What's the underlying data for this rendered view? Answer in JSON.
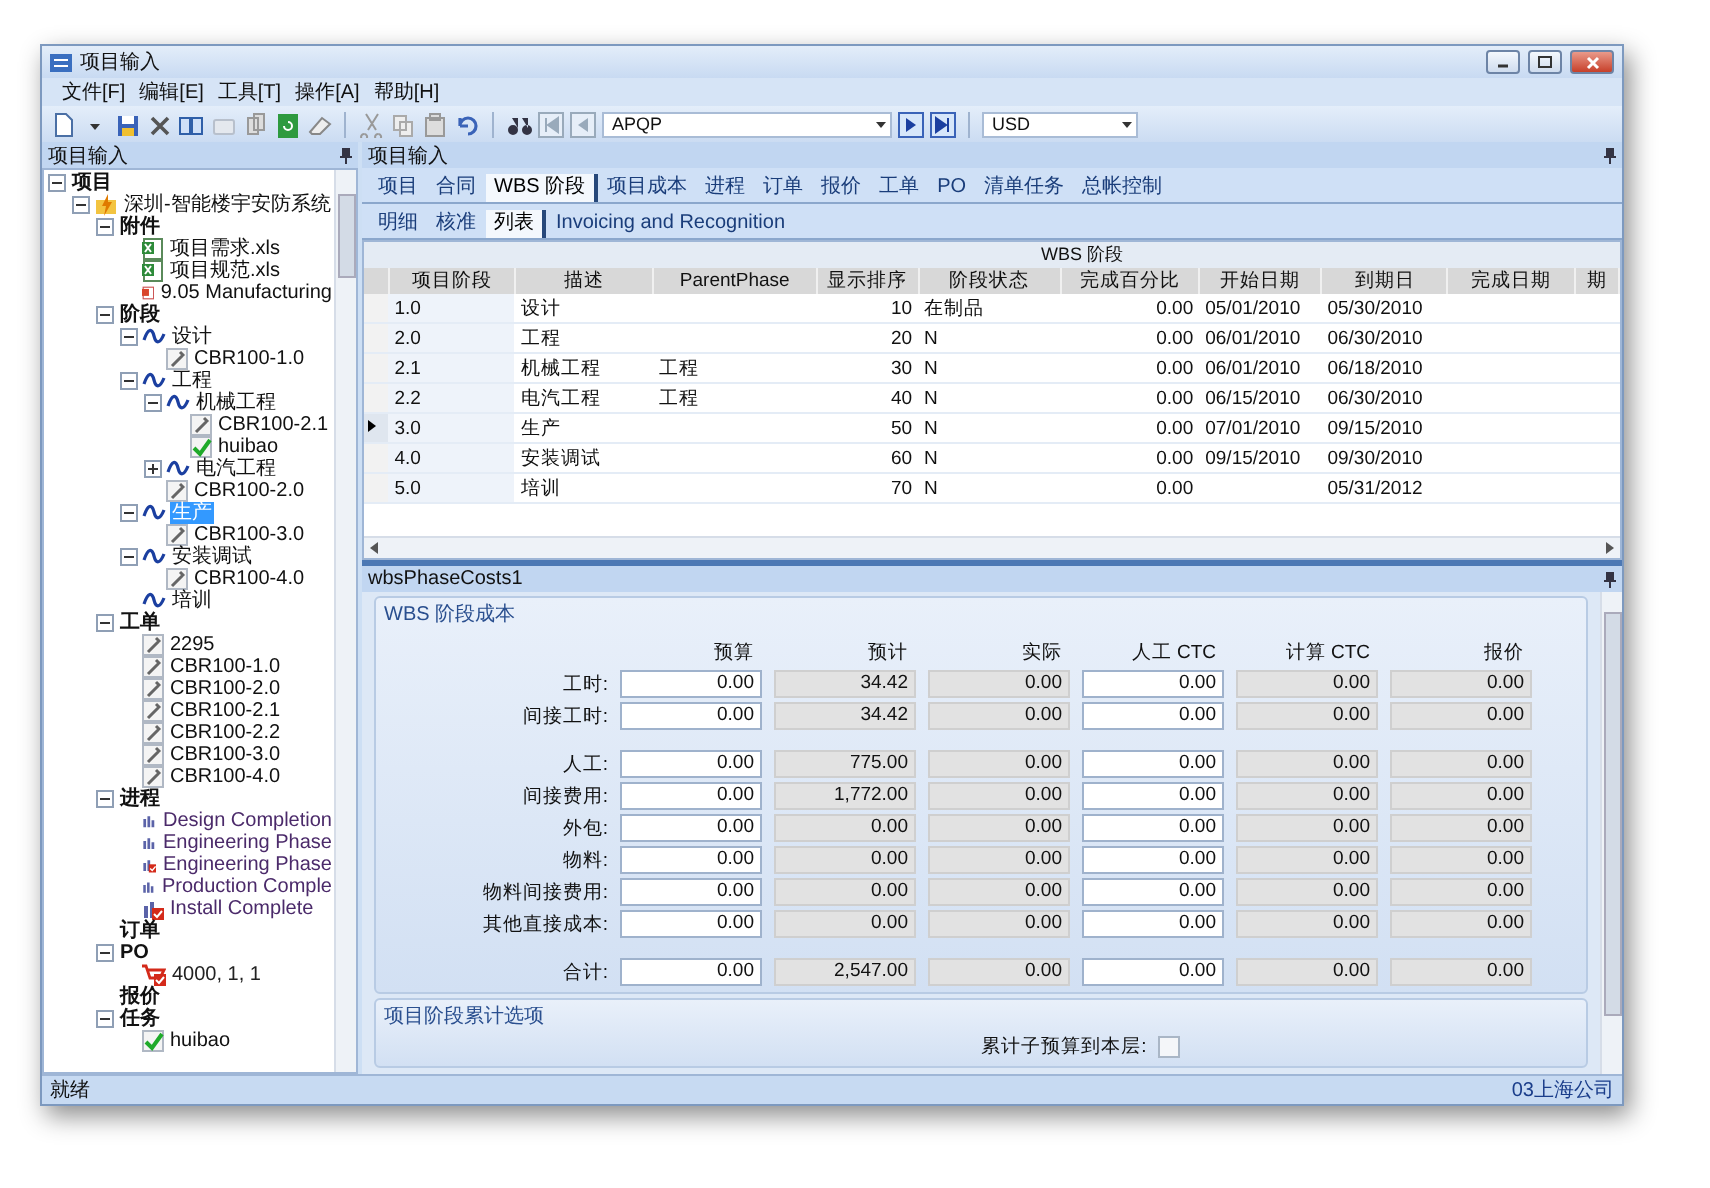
{
  "window": {
    "title": "项目输入"
  },
  "menu": [
    "文件[F]",
    "编辑[E]",
    "工具[T]",
    "操作[A]",
    "帮助[H]"
  ],
  "toolbar": {
    "record_combo": {
      "value": "APQP"
    },
    "currency_combo": {
      "value": "USD"
    }
  },
  "left_panel": {
    "title": "项目输入",
    "tree": [
      {
        "label": "项目",
        "kind": "category",
        "expanded": true,
        "selected": false,
        "children": [
          {
            "label": "深圳-智能楼宇安防系统",
            "kind": "project",
            "expanded": true,
            "selected": false,
            "children": [
              {
                "label": "附件",
                "kind": "category",
                "expanded": true,
                "selected": false,
                "children": [
                  {
                    "label": "项目需求.xls",
                    "kind": "excel",
                    "selected": false
                  },
                  {
                    "label": "项目规范.xls",
                    "kind": "excel",
                    "selected": false
                  },
                  {
                    "label": "9.05 Manufacturing",
                    "kind": "document",
                    "selected": false
                  }
                ]
              },
              {
                "label": "阶段",
                "kind": "category",
                "expanded": true,
                "selected": false,
                "children": [
                  {
                    "label": "设计",
                    "kind": "phase",
                    "expanded": true,
                    "selected": false,
                    "children": [
                      {
                        "label": "CBR100-1.0",
                        "kind": "work-order",
                        "selected": false
                      }
                    ]
                  },
                  {
                    "label": "工程",
                    "kind": "phase",
                    "expanded": true,
                    "selected": false,
                    "children": [
                      {
                        "label": "机械工程",
                        "kind": "phase",
                        "expanded": true,
                        "selected": false,
                        "children": [
                          {
                            "label": "CBR100-2.1",
                            "kind": "work-order",
                            "selected": false
                          },
                          {
                            "label": "huibao",
                            "kind": "task",
                            "selected": false
                          }
                        ]
                      },
                      {
                        "label": "电汽工程",
                        "kind": "phase",
                        "expanded": false,
                        "selected": false
                      },
                      {
                        "label": "CBR100-2.0",
                        "kind": "work-order",
                        "selected": false
                      }
                    ]
                  },
                  {
                    "label": "生产",
                    "kind": "phase",
                    "expanded": true,
                    "selected": true,
                    "children": [
                      {
                        "label": "CBR100-3.0",
                        "kind": "work-order",
                        "selected": false
                      }
                    ]
                  },
                  {
                    "label": "安装调试",
                    "kind": "phase",
                    "expanded": true,
                    "selected": false,
                    "children": [
                      {
                        "label": "CBR100-4.0",
                        "kind": "work-order",
                        "selected": false
                      }
                    ]
                  },
                  {
                    "label": "培训",
                    "kind": "phase",
                    "selected": false
                  }
                ]
              },
              {
                "label": "工单",
                "kind": "category",
                "expanded": true,
                "selected": false,
                "children": [
                  {
                    "label": "2295",
                    "kind": "work-order",
                    "selected": false
                  },
                  {
                    "label": "CBR100-1.0",
                    "kind": "work-order",
                    "selected": false
                  },
                  {
                    "label": "CBR100-2.0",
                    "kind": "work-order",
                    "selected": false
                  },
                  {
                    "label": "CBR100-2.1",
                    "kind": "work-order",
                    "selected": false
                  },
                  {
                    "label": "CBR100-2.2",
                    "kind": "work-order",
                    "selected": false
                  },
                  {
                    "label": "CBR100-3.0",
                    "kind": "work-order",
                    "selected": false
                  },
                  {
                    "label": "CBR100-4.0",
                    "kind": "work-order",
                    "selected": false
                  }
                ]
              },
              {
                "label": "进程",
                "kind": "category",
                "expanded": true,
                "selected": false,
                "children": [
                  {
                    "label": "Design Completion",
                    "kind": "milestone",
                    "selected": false
                  },
                  {
                    "label": "Engineering Phase",
                    "kind": "milestone",
                    "selected": false
                  },
                  {
                    "label": "Engineering Phase",
                    "kind": "milestone-done",
                    "selected": false
                  },
                  {
                    "label": "Production Comple",
                    "kind": "milestone",
                    "selected": false
                  },
                  {
                    "label": "Install Complete",
                    "kind": "milestone-done",
                    "selected": false
                  }
                ]
              },
              {
                "label": "订单",
                "kind": "category",
                "selected": false
              },
              {
                "label": "PO",
                "kind": "category",
                "expanded": true,
                "selected": false,
                "children": [
                  {
                    "label": "4000, 1, 1",
                    "kind": "po",
                    "selected": false
                  }
                ]
              },
              {
                "label": "报价",
                "kind": "category",
                "selected": false
              },
              {
                "label": "任务",
                "kind": "category",
                "expanded": true,
                "selected": false,
                "children": [
                  {
                    "label": "huibao",
                    "kind": "task",
                    "selected": false
                  }
                ]
              }
            ]
          }
        ]
      }
    ]
  },
  "right_panel": {
    "title": "项目输入",
    "tabs": [
      {
        "label": "项目",
        "selected": false
      },
      {
        "label": "合同",
        "selected": false
      },
      {
        "label": "WBS 阶段",
        "selected": true
      },
      {
        "label": "项目成本",
        "selected": false
      },
      {
        "label": "进程",
        "selected": false
      },
      {
        "label": "订单",
        "selected": false
      },
      {
        "label": "报价",
        "selected": false
      },
      {
        "label": "工单",
        "selected": false
      },
      {
        "label": "PO",
        "selected": false
      },
      {
        "label": "清单任务",
        "selected": false
      },
      {
        "label": "总帐控制",
        "selected": false
      }
    ],
    "subtabs": [
      {
        "label": "明细",
        "selected": false
      },
      {
        "label": "核准",
        "selected": false
      },
      {
        "label": "列表",
        "selected": true
      },
      {
        "label": "Invoicing and Recognition",
        "selected": false
      }
    ],
    "table": {
      "group_header": "WBS 阶段",
      "columns": [
        {
          "label": "项目阶段",
          "kind": "text"
        },
        {
          "label": "描述",
          "kind": "text"
        },
        {
          "label": "ParentPhase",
          "kind": "text"
        },
        {
          "label": "显示排序",
          "kind": "number"
        },
        {
          "label": "阶段状态",
          "kind": "text"
        },
        {
          "label": "完成百分比",
          "kind": "number"
        },
        {
          "label": "开始日期",
          "kind": "text"
        },
        {
          "label": "到期日",
          "kind": "text"
        },
        {
          "label": "完成日期",
          "kind": "text"
        },
        {
          "label": "期",
          "kind": "text"
        }
      ],
      "rows": [
        {
          "selected": false,
          "cells": [
            "1.0",
            "设计",
            null,
            "10",
            "在制品",
            "0.00",
            "05/01/2010",
            "05/30/2010",
            null,
            null
          ]
        },
        {
          "selected": false,
          "cells": [
            "2.0",
            "工程",
            null,
            "20",
            "N",
            "0.00",
            "06/01/2010",
            "06/30/2010",
            null,
            null
          ]
        },
        {
          "selected": false,
          "cells": [
            "2.1",
            "机械工程",
            "工程",
            "30",
            "N",
            "0.00",
            "06/01/2010",
            "06/18/2010",
            null,
            null
          ]
        },
        {
          "selected": false,
          "cells": [
            "2.2",
            "电汽工程",
            "工程",
            "40",
            "N",
            "0.00",
            "06/15/2010",
            "06/30/2010",
            null,
            null
          ]
        },
        {
          "selected": true,
          "cells": [
            "3.0",
            "生产",
            null,
            "50",
            "N",
            "0.00",
            "07/01/2010",
            "09/15/2010",
            null,
            null
          ]
        },
        {
          "selected": false,
          "cells": [
            "4.0",
            "安装调试",
            null,
            "60",
            "N",
            "0.00",
            "09/15/2010",
            "09/30/2010",
            null,
            null
          ]
        },
        {
          "selected": false,
          "cells": [
            "5.0",
            "培训",
            null,
            "70",
            "N",
            "0.00",
            null,
            "05/31/2012",
            null,
            null
          ]
        }
      ]
    },
    "phase_costs": {
      "panel_title": "wbsPhaseCosts1",
      "group_title": "WBS 阶段成本",
      "columns": [
        {
          "label": "预算",
          "editable": true
        },
        {
          "label": "预计",
          "editable": false
        },
        {
          "label": "实际",
          "editable": false
        },
        {
          "label": "人工 CTC",
          "editable": true
        },
        {
          "label": "计算 CTC",
          "editable": false
        },
        {
          "label": "报价",
          "editable": false
        }
      ],
      "row_groups": [
        [
          {
            "label": "工时:",
            "values": [
              "0.00",
              "34.42",
              "0.00",
              "0.00",
              "0.00",
              "0.00"
            ]
          },
          {
            "label": "间接工时:",
            "values": [
              "0.00",
              "34.42",
              "0.00",
              "0.00",
              "0.00",
              "0.00"
            ]
          }
        ],
        [
          {
            "label": "人工:",
            "values": [
              "0.00",
              "775.00",
              "0.00",
              "0.00",
              "0.00",
              "0.00"
            ]
          },
          {
            "label": "间接费用:",
            "values": [
              "0.00",
              "1,772.00",
              "0.00",
              "0.00",
              "0.00",
              "0.00"
            ]
          },
          {
            "label": "外包:",
            "values": [
              "0.00",
              "0.00",
              "0.00",
              "0.00",
              "0.00",
              "0.00"
            ]
          },
          {
            "label": "物料:",
            "values": [
              "0.00",
              "0.00",
              "0.00",
              "0.00",
              "0.00",
              "0.00"
            ]
          },
          {
            "label": "物料间接费用:",
            "values": [
              "0.00",
              "0.00",
              "0.00",
              "0.00",
              "0.00",
              "0.00"
            ]
          },
          {
            "label": "其他直接成本:",
            "values": [
              "0.00",
              "0.00",
              "0.00",
              "0.00",
              "0.00",
              "0.00"
            ]
          }
        ],
        [
          {
            "label": "合计:",
            "values": [
              "0.00",
              "2,547.00",
              "0.00",
              "0.00",
              "0.00",
              "0.00"
            ]
          }
        ]
      ],
      "options": {
        "title": "项目阶段累计选项",
        "items": [
          {
            "label": "累计子预算到本层:",
            "checked": false
          }
        ]
      }
    }
  },
  "status_bar": {
    "left": "就绪",
    "right": "03上海公司"
  }
}
